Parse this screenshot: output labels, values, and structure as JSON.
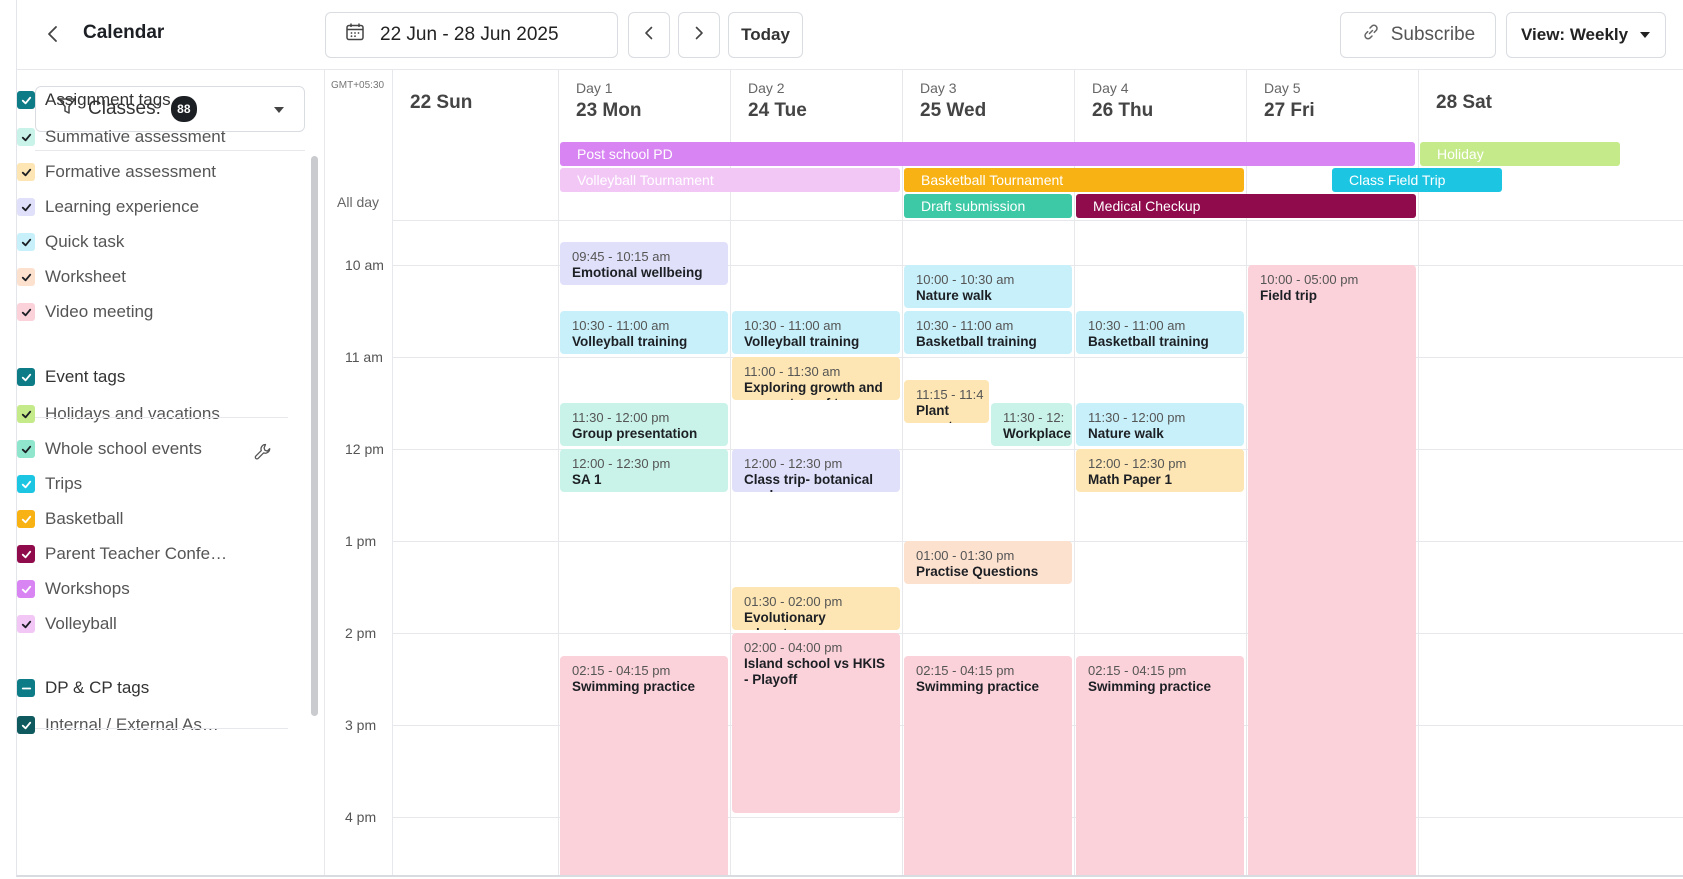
{
  "header": {
    "title": "Calendar",
    "date_range": "22 Jun - 28 Jun 2025",
    "today": "Today",
    "subscribe": "Subscribe",
    "view": "View: Weekly"
  },
  "sidebar": {
    "classes_label": "Classes:",
    "classes_count": "88",
    "groups": [
      {
        "label": "Assignment tags",
        "items": [
          {
            "label": "Summative assessment",
            "color": "#c9f3e9"
          },
          {
            "label": "Formative assessment",
            "color": "#fde6b3"
          },
          {
            "label": "Learning experience",
            "color": "#e0e0fa"
          },
          {
            "label": "Quick task",
            "color": "#c8f0fa"
          },
          {
            "label": "Worksheet",
            "color": "#fde1cf"
          },
          {
            "label": "Video meeting",
            "color": "#fbd2da"
          }
        ]
      },
      {
        "label": "Event tags",
        "items": [
          {
            "label": "Holidays and vacations",
            "color": "#c5ea8a"
          },
          {
            "label": "Whole school events",
            "color": "#8fe6cd"
          },
          {
            "label": "Trips",
            "color": "#1cc6e3"
          },
          {
            "label": "Basketball",
            "color": "#f8b214"
          },
          {
            "label": "Parent Teacher Confe…",
            "color": "#8f0b4c"
          },
          {
            "label": "Workshops",
            "color": "#d884f2"
          },
          {
            "label": "Volleyball",
            "color": "#f2c7f6"
          }
        ]
      },
      {
        "label": "DP & CP tags",
        "items": [
          {
            "label": "Internal / External As…",
            "color": "#0e5a5e"
          }
        ]
      }
    ]
  },
  "calendar": {
    "timezone": "GMT+05:30",
    "allday_label": "All day",
    "days": [
      {
        "sub": "",
        "name": "22 Sun"
      },
      {
        "sub": "Day 1",
        "name": "23 Mon"
      },
      {
        "sub": "Day 2",
        "name": "24 Tue"
      },
      {
        "sub": "Day 3",
        "name": "25 Wed"
      },
      {
        "sub": "Day 4",
        "name": "26 Thu"
      },
      {
        "sub": "Day 5",
        "name": "27 Fri"
      },
      {
        "sub": "",
        "name": "28 Sat"
      }
    ],
    "hours": [
      "10 am",
      "11 am",
      "12 pm",
      "1 pm",
      "2 pm",
      "3 pm",
      "4 pm"
    ],
    "allday_events": [
      {
        "label": "Post school PD",
        "color": "#d884f2",
        "text_color": "#ffffff"
      },
      {
        "label": "Holiday",
        "color": "#c5ea8a",
        "text_color": "#ffffff"
      },
      {
        "label": "Volleyball Tournament",
        "color": "#f2c7f6",
        "text_color": "#ffffff"
      },
      {
        "label": "Basketball Tournament",
        "color": "#f8b214",
        "text_color": "#ffffff"
      },
      {
        "label": "Class Field Trip",
        "color": "#1cc6e3",
        "text_color": "#ffffff"
      },
      {
        "label": "Draft submission",
        "color": "#3dc9a5",
        "text_color": "#ffffff"
      },
      {
        "label": "Medical Checkup",
        "color": "#8f0b4c",
        "text_color": "#ffffff"
      }
    ],
    "events": [
      {
        "time": "09:45 - 10:15 am",
        "name": "Emotional wellbeing",
        "color": "#e0e0fa"
      },
      {
        "time": "10:30 - 11:00 am",
        "name": "Volleyball training",
        "color": "#c8f0fa"
      },
      {
        "time": "11:30 - 12:00 pm",
        "name": "Group presentation",
        "color": "#c9f3e9"
      },
      {
        "time": "12:00 - 12:30 pm",
        "name": "SA 1",
        "color": "#c9f3e9"
      },
      {
        "time": "02:15 - 04:15 pm",
        "name": "Swimming practice",
        "color": "#fbd2da"
      },
      {
        "time": "10:30 - 11:00 am",
        "name": "Volleyball training",
        "color": "#c8f0fa"
      },
      {
        "time": "11:00 - 11:30 am",
        "name": "Exploring growth and ecosystem of trees",
        "color": "#fde6b3"
      },
      {
        "time": "12:00 - 12:30 pm",
        "name": "Class trip- botanical garden",
        "color": "#e0e0fa"
      },
      {
        "time": "01:30 - 02:00 pm",
        "name": "Evolutionary advantage",
        "color": "#fde6b3"
      },
      {
        "time": "02:00 - 04:00 pm",
        "name": "Island school vs HKIS - Playoff",
        "color": "#fbd2da"
      },
      {
        "time": "10:00 - 10:30 am",
        "name": "Nature walk",
        "color": "#c8f0fa"
      },
      {
        "time": "10:30 - 11:00 am",
        "name": "Basketball training",
        "color": "#c8f0fa"
      },
      {
        "time": "11:15 - 11:4",
        "name": "Plant growt",
        "color": "#fde6b3"
      },
      {
        "time": "11:30 - 12:",
        "name": "Workplace",
        "color": "#c9f3e9"
      },
      {
        "time": "01:00 - 01:30 pm",
        "name": "Practise Questions",
        "color": "#fde1cf"
      },
      {
        "time": "02:15 - 04:15 pm",
        "name": "Swimming practice",
        "color": "#fbd2da"
      },
      {
        "time": "10:30 - 11:00 am",
        "name": "Basketball training",
        "color": "#c8f0fa"
      },
      {
        "time": "11:30 - 12:00 pm",
        "name": "Nature walk",
        "color": "#c8f0fa"
      },
      {
        "time": "12:00 - 12:30 pm",
        "name": "Math Paper 1",
        "color": "#fde6b3"
      },
      {
        "time": "02:15 - 04:15 pm",
        "name": "Swimming practice",
        "color": "#fbd2da"
      },
      {
        "time": "10:00 - 05:00 pm",
        "name": "Field trip",
        "color": "#fbd2da"
      }
    ]
  }
}
